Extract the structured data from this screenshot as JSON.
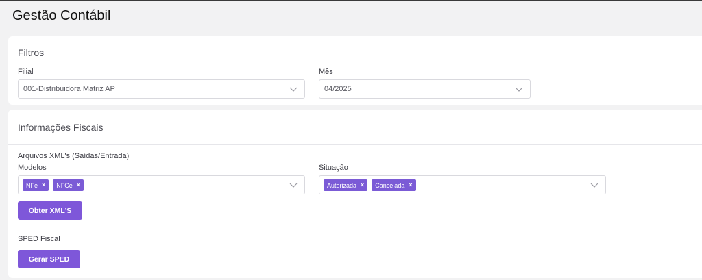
{
  "page": {
    "title": "Gestão Contábil"
  },
  "filtros": {
    "title": "Filtros",
    "filial": {
      "label": "Filial",
      "value": "001-Distribuidora Matriz AP"
    },
    "mes": {
      "label": "Mês",
      "value": "04/2025"
    }
  },
  "fiscal": {
    "title": "Informações Fiscais",
    "xml": {
      "section_label": "Arquivos XML's (Saídas/Entrada)",
      "modelos": {
        "label": "Modelos",
        "tags": [
          "NFe",
          "NFCe"
        ]
      },
      "situacao": {
        "label": "Situação",
        "tags": [
          "Autorizada",
          "Cancelada"
        ]
      },
      "button": "Obter XML'S"
    },
    "sped": {
      "section_label": "SPED Fiscal",
      "button": "Gerar SPED"
    }
  },
  "icons": {
    "chevron": "chevron-down-icon",
    "remove": "close-icon"
  },
  "colors": {
    "accent": "#7e57d9",
    "tag": "#7b5bd6"
  }
}
